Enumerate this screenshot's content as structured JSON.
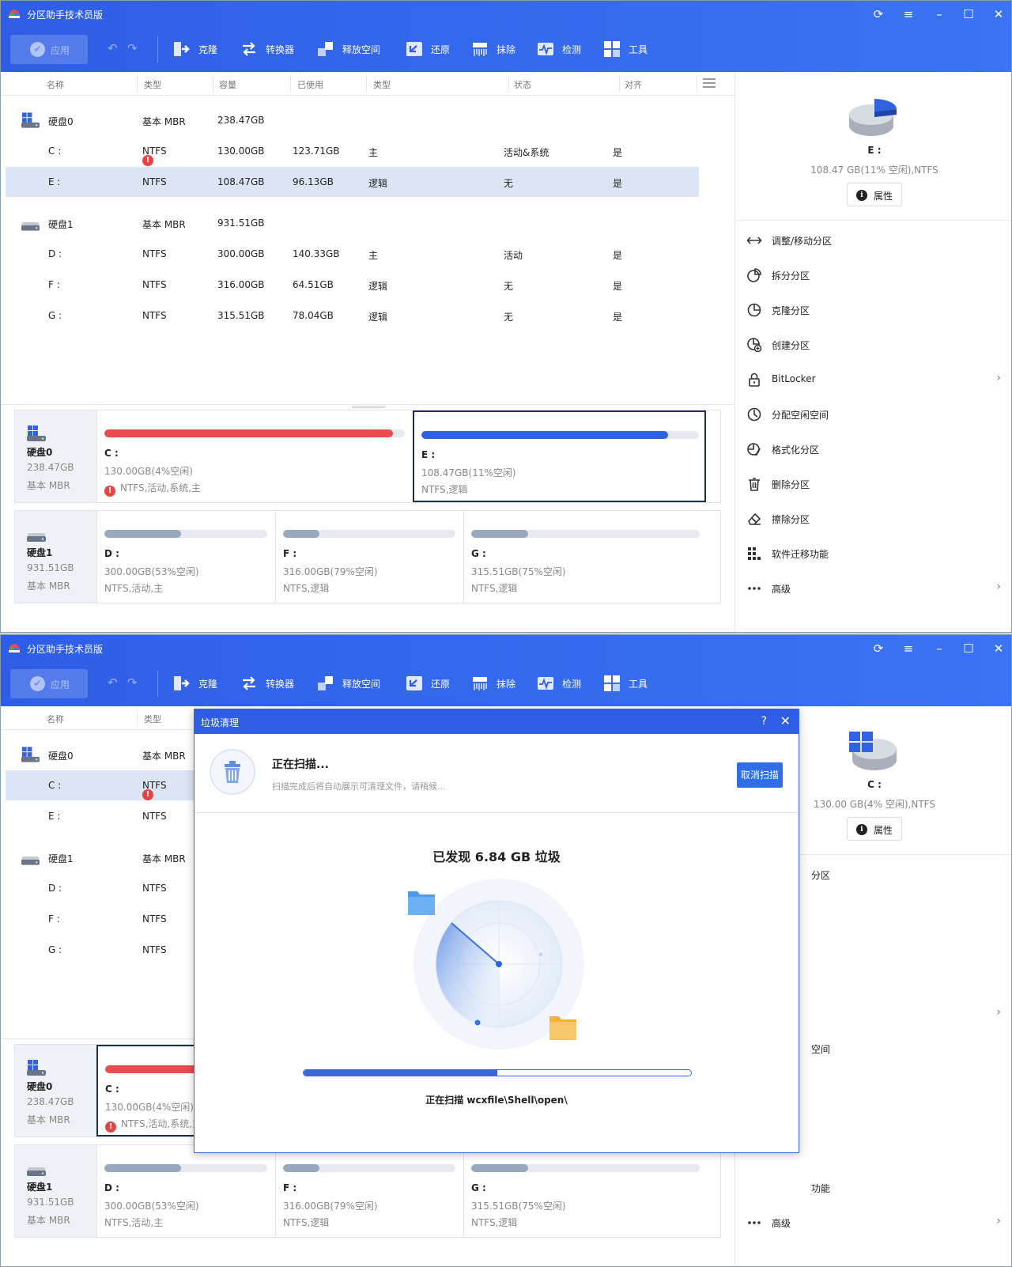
{
  "app_title": "分区助手技术员版",
  "toolbar": {
    "apply": "应用",
    "tools": [
      {
        "label": "克隆",
        "icon": "clone-icon"
      },
      {
        "label": "转换器",
        "icon": "converter-icon"
      },
      {
        "label": "释放空间",
        "icon": "free-space-icon"
      },
      {
        "label": "还原",
        "icon": "restore-icon"
      },
      {
        "label": "抹除",
        "icon": "wipe-icon"
      },
      {
        "label": "检测",
        "icon": "check-icon"
      },
      {
        "label": "工具",
        "icon": "tools-grid-icon"
      }
    ]
  },
  "columns": [
    "名称",
    "类型",
    "容量",
    "已使用",
    "类型",
    "状态",
    "对齐"
  ],
  "disks": [
    {
      "name": "硬盘0",
      "type": "基本 MBR",
      "capacity": "238.47GB",
      "partitions": [
        {
          "letter": "C :",
          "fs": "NTFS",
          "warn": true,
          "capacity": "130.00GB",
          "used": "123.71GB",
          "ptype": "主",
          "status": "活动&系统",
          "aligned": "是"
        },
        {
          "letter": "E :",
          "fs": "NTFS",
          "warn": false,
          "capacity": "108.47GB",
          "used": "96.13GB",
          "ptype": "逻辑",
          "status": "无",
          "aligned": "是"
        }
      ]
    },
    {
      "name": "硬盘1",
      "type": "基本 MBR",
      "capacity": "931.51GB",
      "partitions": [
        {
          "letter": "D :",
          "fs": "NTFS",
          "warn": false,
          "capacity": "300.00GB",
          "used": "140.33GB",
          "ptype": "主",
          "status": "活动",
          "aligned": "是"
        },
        {
          "letter": "F :",
          "fs": "NTFS",
          "warn": false,
          "capacity": "316.00GB",
          "used": "64.51GB",
          "ptype": "逻辑",
          "status": "无",
          "aligned": "是"
        },
        {
          "letter": "G :",
          "fs": "NTFS",
          "warn": false,
          "capacity": "315.51GB",
          "used": "78.04GB",
          "ptype": "逻辑",
          "status": "无",
          "aligned": "是"
        }
      ]
    }
  ],
  "map": {
    "disk0": {
      "name": "硬盘0",
      "size": "238.47GB",
      "type": "基本 MBR",
      "parts": [
        {
          "letter": "C :",
          "size": "130.00GB(4%空闲)",
          "fs": "NTFS,活动,系统,主",
          "used_fraction": 0.96,
          "color": "#e84c4c",
          "warn": true
        },
        {
          "letter": "E :",
          "size": "108.47GB(11%空闲)",
          "fs": "NTFS,逻辑",
          "used_fraction": 0.89,
          "color": "#2f63e0",
          "warn": false
        }
      ]
    },
    "disk1": {
      "name": "硬盘1",
      "size": "931.51GB",
      "type": "基本 MBR",
      "parts": [
        {
          "letter": "D :",
          "size": "300.00GB(53%空闲)",
          "fs": "NTFS,活动,主",
          "used_fraction": 0.47,
          "color": "#98a8bf",
          "warn": false
        },
        {
          "letter": "F :",
          "size": "316.00GB(79%空闲)",
          "fs": "NTFS,逻辑",
          "used_fraction": 0.21,
          "color": "#98a8bf",
          "warn": false
        },
        {
          "letter": "G :",
          "size": "315.51GB(75%空闲)",
          "fs": "NTFS,逻辑",
          "used_fraction": 0.25,
          "color": "#98a8bf",
          "warn": false
        }
      ]
    }
  },
  "side1": {
    "partition": "E :",
    "desc": "108.47 GB(11% 空闲),NTFS",
    "properties": "属性",
    "ops": [
      {
        "label": "调整/移动分区",
        "icon": "resize-move-icon"
      },
      {
        "label": "拆分分区",
        "icon": "split-partition-icon"
      },
      {
        "label": "克隆分区",
        "icon": "clone-partition-icon"
      },
      {
        "label": "创建分区",
        "icon": "create-partition-icon"
      },
      {
        "label": "BitLocker",
        "icon": "lock-icon",
        "arrow": true
      },
      {
        "label": "分配空闲空间",
        "icon": "allocate-space-icon"
      },
      {
        "label": "格式化分区",
        "icon": "format-partition-icon"
      },
      {
        "label": "删除分区",
        "icon": "trash-icon"
      },
      {
        "label": "擦除分区",
        "icon": "eraser-icon"
      },
      {
        "label": "软件迁移功能",
        "icon": "app-migrate-icon"
      },
      {
        "label": "高级",
        "icon": "more-icon",
        "arrow": true
      }
    ]
  },
  "side2": {
    "partition": "C :",
    "desc": "130.00 GB(4% 空闲),NTFS",
    "properties": "属性",
    "visible_ops": [
      {
        "label": "分区",
        "row": 0
      },
      {
        "label": "空间",
        "row": 5
      },
      {
        "label": "功能",
        "row": 9
      },
      {
        "label": "高级",
        "row": 10,
        "icon": true
      }
    ]
  },
  "dialog": {
    "title": "垃圾清理",
    "help": "?",
    "close": "✕",
    "status": "正在扫描...",
    "hint": "扫描完成后将自动展示可清理文件，请稍候...",
    "cancel": "取消扫描",
    "found": "已发现 6.84 GB 垃圾",
    "progress": 0.5,
    "scanning": "正在扫描 wcxfile\\Shell\\open\\"
  },
  "colors": {
    "brand": "#2f5ee6",
    "selected_row": "#dbe5f4",
    "c_bar": "#e84c4c",
    "e_bar": "#2f63e0"
  }
}
